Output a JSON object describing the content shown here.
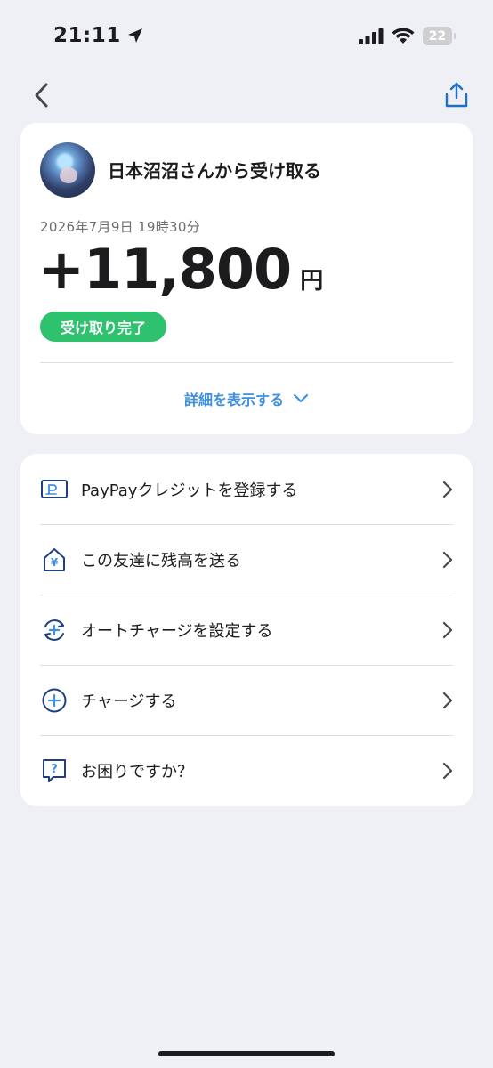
{
  "status_bar": {
    "time": "21:11",
    "battery": "22"
  },
  "header": {
    "back_icon": "chevron-left-icon",
    "share_icon": "share-icon"
  },
  "transaction": {
    "sender_title": "日本沼沼さんから受け取る",
    "date": "2026年7月9日 19時30分",
    "amount": "+11,800",
    "unit": "円",
    "status": "受け取り完了",
    "details_link": "詳細を表示する"
  },
  "menu": {
    "items": [
      {
        "label": "PayPayクレジットを登録する",
        "icon": "paypay-card-icon"
      },
      {
        "label": "この友達に残高を送る",
        "icon": "send-yen-icon"
      },
      {
        "label": "オートチャージを設定する",
        "icon": "auto-charge-icon"
      },
      {
        "label": "チャージする",
        "icon": "plus-circle-icon"
      },
      {
        "label": "お困りですか？",
        "icon": "help-icon"
      }
    ]
  },
  "colors": {
    "accent_blue": "#3d8fe0",
    "icon_navy": "#1f3f82",
    "status_green": "#2ec26e",
    "background": "#eff0f5"
  }
}
